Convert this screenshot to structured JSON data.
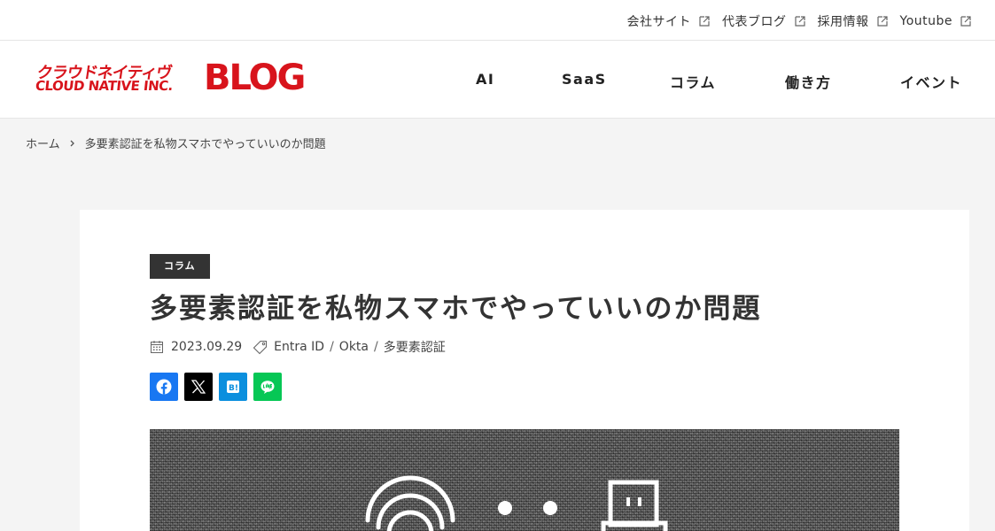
{
  "topbar": {
    "links": [
      {
        "label": "会社サイト"
      },
      {
        "label": "代表ブログ"
      },
      {
        "label": "採用情報"
      },
      {
        "label": "Youtube"
      }
    ]
  },
  "header": {
    "logo": {
      "jp": "クラウドネイティヴ",
      "en": "CLOUD NATIVE INC.",
      "blog": "BLOG"
    },
    "nav": [
      {
        "label": "AI"
      },
      {
        "label": "SaaS"
      },
      {
        "label": "コラム"
      },
      {
        "label": "働き方"
      },
      {
        "label": "イベント"
      }
    ]
  },
  "breadcrumb": {
    "home": "ホーム",
    "current": "多要素認証を私物スマホでやっていいのか問題"
  },
  "article": {
    "category": "コラム",
    "title": "多要素認証を私物スマホでやっていいのか問題",
    "date": "2023.09.29",
    "tags": [
      "Entra ID",
      "Okta",
      "多要素認証"
    ],
    "tag_separator": "/",
    "share": [
      {
        "name": "facebook",
        "color": "#1877f2",
        "icon": "facebook-icon"
      },
      {
        "name": "x",
        "color": "#000000",
        "icon": "x-icon"
      },
      {
        "name": "hatena",
        "color": "#0b8fde",
        "icon": "hatena-bookmark-icon"
      },
      {
        "name": "line",
        "color": "#06c755",
        "icon": "line-icon"
      }
    ]
  },
  "colors": {
    "brand": "#d8141c",
    "category_bg": "#333333",
    "page_bg": "#f4f4f4"
  }
}
